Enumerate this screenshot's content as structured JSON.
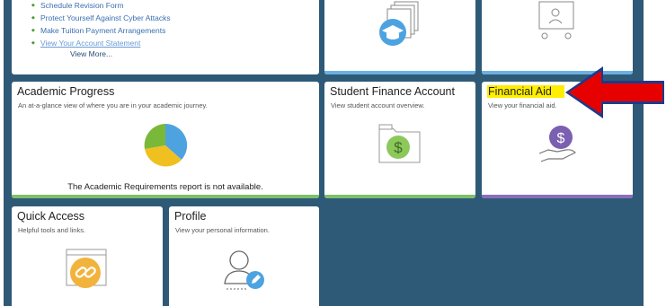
{
  "links_tile": {
    "items": [
      "Schedule Revision Form",
      "Protect Yourself Against Cyber Attacks",
      "Make Tuition Payment Arrangements",
      "View Your Account Statement"
    ],
    "view_more": "View More..."
  },
  "academic_progress": {
    "title": "Academic Progress",
    "subtitle": "An at-a-glance view of where you are in your academic journey.",
    "note": "The Academic Requirements report is not available.",
    "pie_colors": [
      "#4da3e0",
      "#f0c020",
      "#7ab83a"
    ]
  },
  "student_finance": {
    "title": "Student Finance Account",
    "subtitle": "View student account overview."
  },
  "financial_aid": {
    "title": "Financial Aid",
    "subtitle": "View your financial aid."
  },
  "quick_access": {
    "title": "Quick Access",
    "subtitle": "Helpful tools and links."
  },
  "profile": {
    "title": "Profile",
    "subtitle": "View your personal information."
  },
  "colors": {
    "background": "#2e5a78",
    "bar_blue": "#6ab0e0",
    "bar_green": "#7ec06a",
    "bar_purple": "#8a6fb8",
    "highlight": "#ffee00",
    "arrow": "#e60000"
  }
}
